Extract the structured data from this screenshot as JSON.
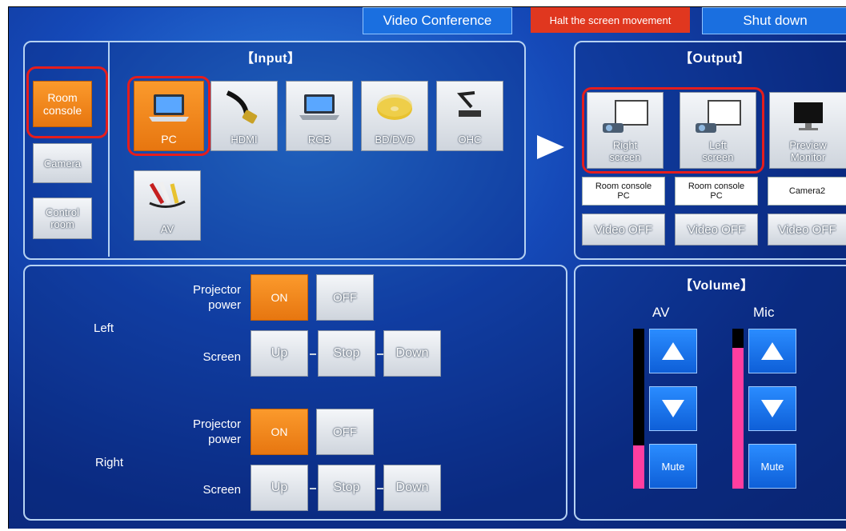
{
  "topbar": {
    "video_conference": "Video Conference",
    "halt": "Halt the screen movement",
    "shutdown": "Shut down"
  },
  "input_panel": {
    "title": "【Input】",
    "sources": [
      {
        "label": "Room console",
        "selected": true
      },
      {
        "label": "Camera",
        "selected": false
      },
      {
        "label": "Control room",
        "selected": false
      }
    ],
    "devices": [
      {
        "label": "PC",
        "icon": "laptop-icon",
        "selected": true
      },
      {
        "label": "HDMI",
        "icon": "hdmi-cable-icon",
        "selected": false
      },
      {
        "label": "RGB",
        "icon": "laptop-icon",
        "selected": false
      },
      {
        "label": "BD/DVD",
        "icon": "disc-icon",
        "selected": false
      },
      {
        "label": "OHC",
        "icon": "document-camera-icon",
        "selected": false
      },
      {
        "label": "AV",
        "icon": "av-cable-icon",
        "selected": false
      }
    ]
  },
  "output_panel": {
    "title": "【Output】",
    "outputs": [
      {
        "label": "Right screen",
        "icon": "projector-screen-icon",
        "source": "Room console PC",
        "video_off": "Video OFF"
      },
      {
        "label": "Left screen",
        "icon": "projector-screen-icon",
        "source": "Room console PC",
        "video_off": "Video OFF"
      },
      {
        "label": "Preview Monitor",
        "icon": "monitor-icon",
        "source": "Camera2",
        "video_off": "Video OFF"
      }
    ]
  },
  "projector_panel": {
    "left": {
      "side_label": "Left",
      "power_label": "Projector power",
      "on": "ON",
      "off": "OFF",
      "power_state": "ON",
      "screen_label": "Screen",
      "up": "Up",
      "stop": "Stop",
      "down": "Down"
    },
    "right": {
      "side_label": "Right",
      "power_label": "Projector power",
      "on": "ON",
      "off": "OFF",
      "power_state": "ON",
      "screen_label": "Screen",
      "up": "Up",
      "stop": "Stop",
      "down": "Down"
    }
  },
  "volume_panel": {
    "title": "【Volume】",
    "channels": [
      {
        "label": "AV",
        "level": 0.27,
        "mute": "Mute"
      },
      {
        "label": "Mic",
        "level": 0.88,
        "mute": "Mute"
      }
    ]
  },
  "colors": {
    "selected": "#f28a1e",
    "highlight_ring": "#e51d1d",
    "meter_fill": "#ff3ea0",
    "blue_button": "#1a6fe0"
  }
}
